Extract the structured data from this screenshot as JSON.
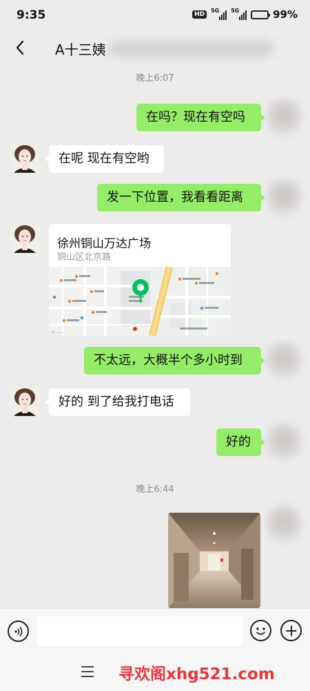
{
  "status_bar": {
    "time": "9:35",
    "hd_badge": "HD",
    "signal_1": "5G",
    "signal_2": "5G",
    "battery_text": "99%",
    "battery_level": 0.99
  },
  "header": {
    "back_icon": "chevron-left-icon",
    "title": "A十三姨"
  },
  "messages": {
    "time_1": "晚上6:07",
    "m1": "在吗？现在有空吗",
    "m2": "在呢 现在有空哟",
    "m3": "发一下位置，我看看距离",
    "location": {
      "name": "徐州铜山万达广场",
      "address": "铜山区北京路",
      "map_labels": [
        "中国建设银行",
        "徐州铜山万达广场",
        "北京路",
        "大润发",
        "北京南路"
      ]
    },
    "m4": "不太远，大概半个多小时到",
    "m5": "好的 到了给我打电话",
    "m6": "好的",
    "time_2": "晚上6:44"
  },
  "input_bar": {
    "voice_icon": "voice-icon",
    "emoji_icon": "emoji-icon",
    "plus_icon": "plus-icon"
  },
  "nav_bar": {
    "menu_icon": "menu-icon"
  },
  "watermark": {
    "text": "寻欢阁xhg521.com",
    "color": "#e8383d"
  },
  "colors": {
    "bubble_me": "#95ec69",
    "bubble_other": "#ffffff",
    "background": "#ececec"
  }
}
